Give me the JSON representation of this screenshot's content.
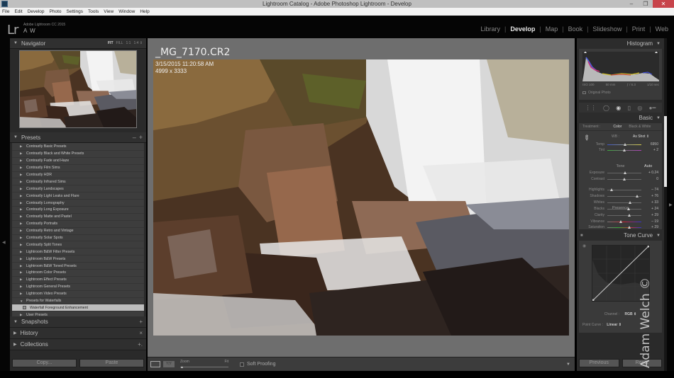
{
  "window": {
    "title": "Lightroom Catalog - Adobe Photoshop Lightroom - Develop",
    "minimize": "–",
    "maximize": "❐",
    "close": "✕"
  },
  "menu": [
    "File",
    "Edit",
    "Develop",
    "Photo",
    "Settings",
    "Tools",
    "View",
    "Window",
    "Help"
  ],
  "identity": {
    "logo": "Lr",
    "product": "Adobe Lightroom CC 2015",
    "user": "A W"
  },
  "modules": [
    "Library",
    "Develop",
    "Map",
    "Book",
    "Slideshow",
    "Print",
    "Web"
  ],
  "active_module": "Develop",
  "navigator": {
    "title": "Navigator",
    "zoom_options": [
      "FIT",
      "FILL",
      "1:1",
      "1:4 ⇕"
    ]
  },
  "presets": {
    "title": "Presets",
    "minus": "–",
    "plus": "+",
    "folders": [
      "Contrastly Basic Presets",
      "Contrastly Black and White Presets",
      "Contrastly Fade and Haze",
      "Contrastly Film Sims",
      "Contrastly HDR",
      "Contrastly Infrared Sims",
      "Contrastly Landscapes",
      "Contrastly Light Leaks and Flare",
      "Contrastly Lomography",
      "Contrastly Long Exposure",
      "Contrastly Matte and Pastel",
      "Contrastly Portraits",
      "Contrastly Retro and Vintage",
      "Contrastly Solar Spots",
      "Contrastly Split Tones",
      "Lightroom B&W Filter Presets",
      "Lightroom B&W Presets",
      "Lightroom B&W Toned Presets",
      "Lightroom Color Presets",
      "Lightroom Effect Presets",
      "Lightroom General Presets",
      "Lightroom Video Presets"
    ],
    "expanded_folder": "Presets for Waterfalls",
    "selected_preset": "Waterfall Foreground Enhancement",
    "last_folder": "User Presets"
  },
  "snapshots": {
    "title": "Snapshots",
    "action": "+"
  },
  "history": {
    "title": "History",
    "action": "×"
  },
  "collections": {
    "title": "Collections",
    "action": "+."
  },
  "left_buttons": {
    "copy": "Copy...",
    "paste": "Paste"
  },
  "image_info": {
    "filename": "_MG_7170.CR2",
    "datetime": "3/15/2015 11:20:58 AM",
    "dimensions": "4999 x 3333"
  },
  "toolbar": {
    "zoom_label": "Zoom",
    "zoom_fit": "Fit",
    "soft_proofing": "Soft Proofing"
  },
  "histogram": {
    "title": "Histogram",
    "iso": "ISO 100",
    "focal": "50 mm",
    "aperture": "ƒ / 6.3",
    "shutter": "1/10 sec",
    "original_photo": "Original Photo"
  },
  "basic": {
    "title": "Basic",
    "treatment_label": "Treatment :",
    "treatment_color": "Color",
    "treatment_bw": "Black & White",
    "wb_label": "WB :",
    "wb_value": "As Shot ⇕",
    "tone_label": "Tone",
    "auto": "Auto",
    "presence_label": "Presence",
    "sliders": [
      {
        "label": "Temp",
        "value": "6950",
        "pos": 0.52
      },
      {
        "label": "Tint",
        "value": "+ 2",
        "pos": 0.51
      },
      {
        "label": "Exposure",
        "value": "+ 0.24",
        "pos": 0.52
      },
      {
        "label": "Contrast",
        "value": "0",
        "pos": 0.5
      },
      {
        "label": "Highlights",
        "value": "– 74",
        "pos": 0.13
      },
      {
        "label": "Shadows",
        "value": "+ 76",
        "pos": 0.88
      },
      {
        "label": "Whites",
        "value": "+ 33",
        "pos": 0.66
      },
      {
        "label": "Blacks",
        "value": "+ 24",
        "pos": 0.62
      },
      {
        "label": "Clarity",
        "value": "+ 29",
        "pos": 0.64
      },
      {
        "label": "Vibrance",
        "value": "– 19",
        "pos": 0.4
      },
      {
        "label": "Saturation",
        "value": "+ 29",
        "pos": 0.64
      }
    ]
  },
  "tone_curve": {
    "title": "Tone Curve",
    "channel_label": "Channel :",
    "channel_value": "RGB ⇕",
    "point_curve_label": "Point Curve :",
    "point_curve_value": "Linear ⇕"
  },
  "right_buttons": {
    "previous": "Previous",
    "reset": "Reset"
  },
  "watermark": "Adam Welch ©"
}
